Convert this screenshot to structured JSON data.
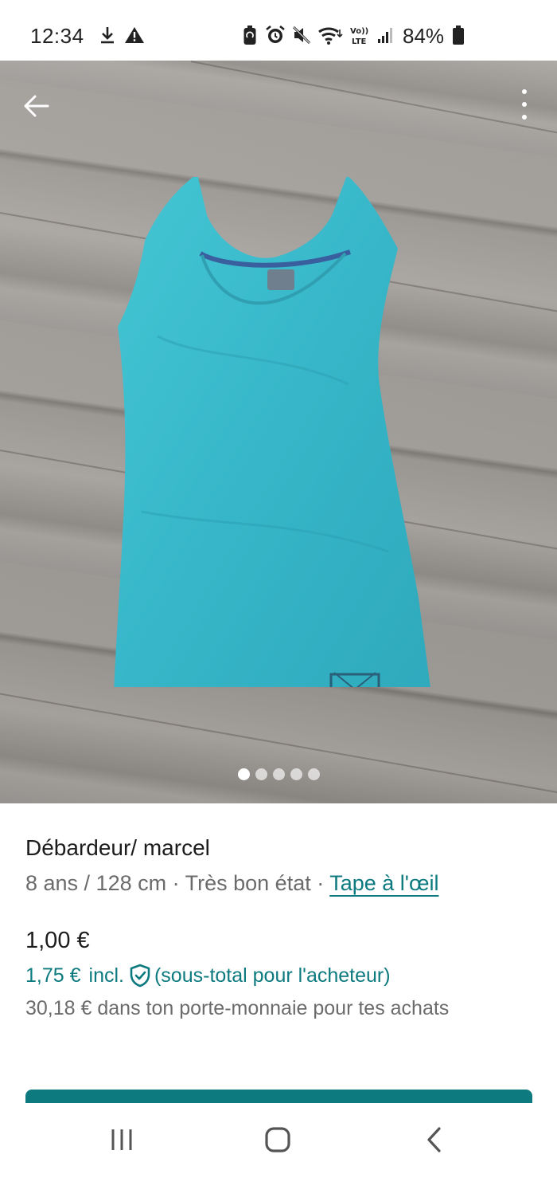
{
  "status_bar": {
    "time": "12:34",
    "battery_percent": "84%",
    "icons": [
      "download-icon",
      "warning-icon",
      "battery-saver-icon",
      "alarm-icon",
      "mute-icon",
      "wifi-icon",
      "volte-icon",
      "signal-icon",
      "battery-icon"
    ],
    "volte_label": "Vo)) LTE"
  },
  "photo": {
    "image_count": 5,
    "active_index": 0,
    "colors": {
      "shirt": "#3cbccc",
      "floor": "#9d9995"
    }
  },
  "item": {
    "title": "Débardeur/ marcel",
    "size": "8 ans / 128 cm",
    "separator_1": " · ",
    "condition": "Très bon état",
    "separator_2": " · ",
    "brand": "Tape à l'œil",
    "price": "1,00 €",
    "price_incl_amount": "1,75 €",
    "price_incl_label": "incl.",
    "price_incl_note": "(sous-total pour l'acheteur)",
    "wallet_text": "30,18 € dans ton porte-monnaie pour tes achats"
  },
  "colors": {
    "accent": "#0d7a7f",
    "text_primary": "#1c1c1c",
    "text_secondary": "#6b6b6b"
  },
  "nav_bar": {
    "buttons": [
      "recents-icon",
      "home-icon",
      "back-nav-icon"
    ]
  }
}
